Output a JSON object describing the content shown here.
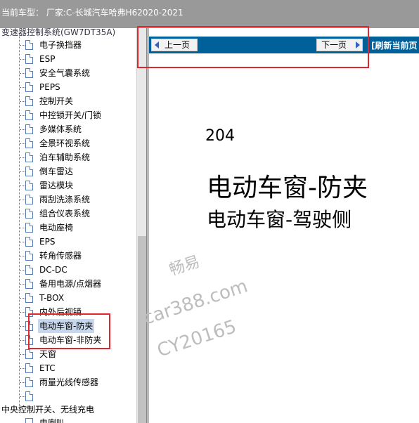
{
  "header": {
    "vehicle_label": "当前车型： 厂家:C-长城汽车哈弗H62020-2021"
  },
  "tree": {
    "top_parent_partial": "变速器控制系统(GW7DT35A)",
    "items": [
      {
        "label": "电子换挡器"
      },
      {
        "label": "ESP"
      },
      {
        "label": "安全气囊系统"
      },
      {
        "label": "PEPS"
      },
      {
        "label": "控制开关"
      },
      {
        "label": "中控锁开关/门锁"
      },
      {
        "label": "多媒体系统"
      },
      {
        "label": "全景环视系统"
      },
      {
        "label": "泊车辅助系统"
      },
      {
        "label": "倒车雷达"
      },
      {
        "label": "雷达模块"
      },
      {
        "label": "雨刮洗涤系统"
      },
      {
        "label": "组合仪表系统"
      },
      {
        "label": "电动座椅"
      },
      {
        "label": "EPS"
      },
      {
        "label": "转角传感器"
      },
      {
        "label": "DC-DC"
      },
      {
        "label": "备用电源/点烟器"
      },
      {
        "label": "T-BOX"
      },
      {
        "label": "内外后视镜"
      },
      {
        "label": "电动车窗-防夹"
      },
      {
        "label": "电动车窗-非防夹"
      },
      {
        "label": "天窗"
      },
      {
        "label": "ETC"
      },
      {
        "label": "雨量光线传感器"
      },
      {
        "label": ""
      }
    ],
    "bottom_parent": "中央控制开关、无线充电",
    "bottom_child_partial": "电喇叭"
  },
  "viewer": {
    "prev_label": "上一页",
    "next_label": "下一页",
    "refresh_label": "[刷新当前页"
  },
  "document": {
    "page_number": "204",
    "title_line1": "电动车窗-防夹",
    "title_line2": "电动车窗-驾驶侧"
  },
  "watermark": {
    "line1": "畅易",
    "line2": "car388.com",
    "line3": "CY20165"
  },
  "colors": {
    "toolbar_bg": "#999999",
    "nav_bg": "#00609a",
    "highlight_red": "#e0262f",
    "selected_bg": "#c7d8ee"
  }
}
